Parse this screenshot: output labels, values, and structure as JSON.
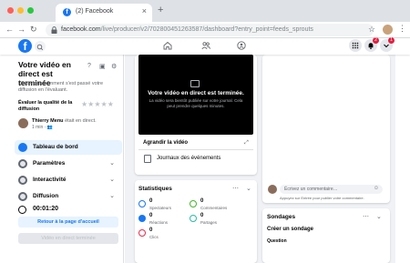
{
  "browser": {
    "tab_title": "(2) Facebook",
    "url_host": "facebook.com",
    "url_path": "/live/producer/v2/702800451263587/dashboard?entry_point=feeds_sprouts"
  },
  "fbnav": {
    "logo_letter": "f",
    "notif_badge": "2",
    "messages_badge": "1"
  },
  "left_panel": {
    "title": "Votre vidéo en direct est terminée",
    "description": "Dites-nous comment s'est passé votre diffusion en l'évaluant.",
    "rating_label": "Évaluer la qualité de la diffusion",
    "stars": "★★★★★",
    "user_name": "Thierry Menu",
    "user_status": " était en direct.",
    "user_time": "1 min",
    "menu": [
      {
        "label": "Tableau de bord"
      },
      {
        "label": "Paramètres"
      },
      {
        "label": "Interactivité"
      },
      {
        "label": "Diffusion"
      }
    ],
    "timer": "00:01:20",
    "back_button": "Retour à la page d'accueil",
    "view_button": "Vidéo en direct terminée"
  },
  "video": {
    "title": "Votre vidéo en direct est terminée.",
    "subtitle": "La vidéo sera bientôt publiée sur votre journal. Cela peut prendre quelques minutes."
  },
  "video_card": {
    "enlarge": "Agrandir la vidéo",
    "journal": "Journaux des événements"
  },
  "stats": {
    "title": "Statistiques",
    "items": [
      {
        "value": "0",
        "label": "Spectateurs",
        "color": "#1877f2"
      },
      {
        "value": "0",
        "label": "Commentaires",
        "color": "#42b72a"
      },
      {
        "value": "0",
        "label": "Réactions",
        "color": "#1877f2"
      },
      {
        "value": "0",
        "label": "Partages",
        "color": "#2abba7"
      },
      {
        "value": "0",
        "label": "Clics",
        "color": "#f02849"
      }
    ]
  },
  "comments": {
    "placeholder": "Écrivez un commentaire…",
    "hint": "Appuyez sur Entrée pour publier votre commentaire."
  },
  "polls": {
    "title": "Sondages",
    "create": "Créer un sondage",
    "question": "Question"
  },
  "colors": {
    "accent": "#1877f2",
    "background": "#f0f2f5"
  }
}
